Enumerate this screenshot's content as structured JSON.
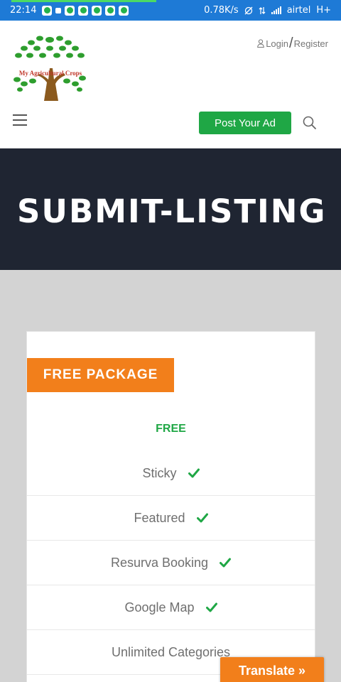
{
  "status_bar": {
    "time": "22:14",
    "net_speed": "0.78K/s",
    "carrier": "airtel",
    "network": "H+"
  },
  "header": {
    "logo_text": "My Agricultural Crops",
    "login_label": "Login",
    "register_label": "Register",
    "post_ad_label": "Post Your Ad"
  },
  "hero": {
    "title": "SUBMIT-LISTING"
  },
  "package": {
    "label": "FREE PACKAGE",
    "price": "FREE",
    "features": [
      {
        "label": "Sticky",
        "included": true
      },
      {
        "label": "Featured",
        "included": true
      },
      {
        "label": "Resurva Booking",
        "included": true
      },
      {
        "label": "Google Map",
        "included": true
      },
      {
        "label": "Unlimited Categories",
        "included": false
      }
    ]
  },
  "translate": {
    "label": "Translate »"
  },
  "colors": {
    "accent_green": "#1fa745",
    "accent_orange": "#f27f1b",
    "hero_bg": "#1f2532",
    "status_bar": "#1e7ad6"
  }
}
